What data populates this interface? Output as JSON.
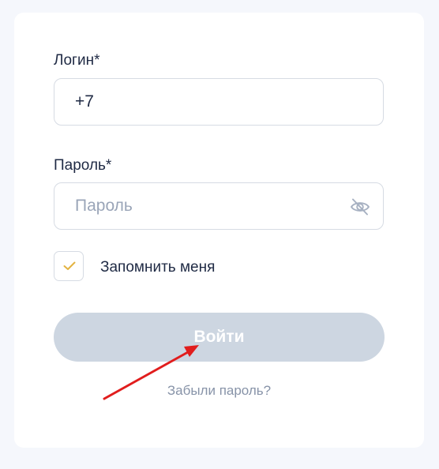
{
  "form": {
    "login_label": "Логин*",
    "login_value": "+7",
    "password_label": "Пароль*",
    "password_placeholder": "Пароль",
    "password_value": "",
    "password_toggle_icon": "eye-off-icon",
    "remember_label": "Запомнить меня",
    "remember_checked": true,
    "submit_label": "Войти",
    "submit_disabled": true,
    "forgot_label": "Забыли пароль?"
  },
  "colors": {
    "page_background": "#f5f7fc",
    "card_background": "#ffffff",
    "input_border": "#d6dbe3",
    "text_primary": "#1f2a44",
    "placeholder": "#9aa5b8",
    "check_mark": "#e3b341",
    "button_disabled": "#cdd6e1",
    "link": "#8793a8",
    "annotation_arrow": "#e11d1d"
  }
}
